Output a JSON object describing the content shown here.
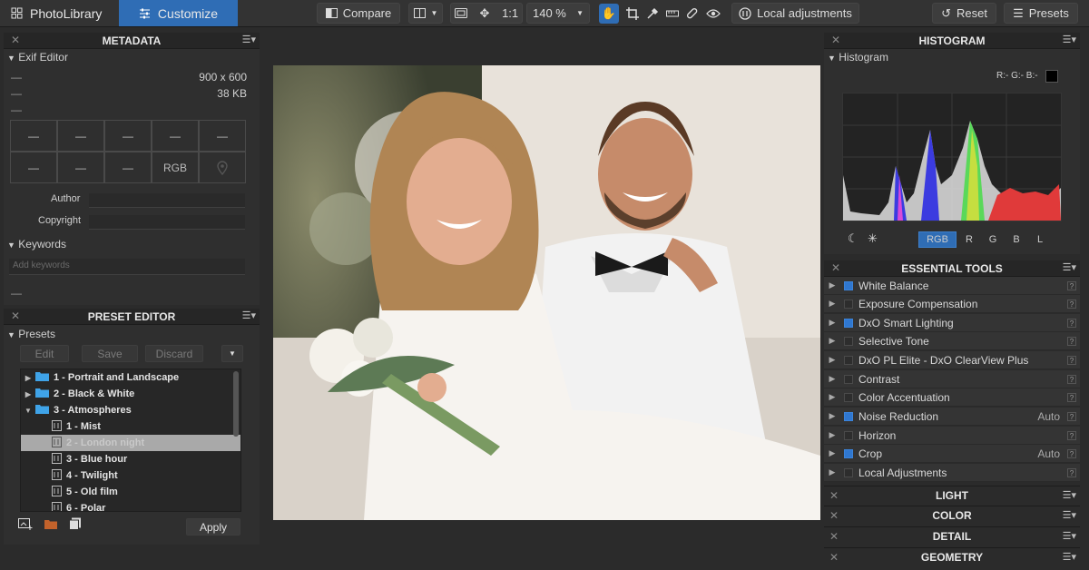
{
  "topbar": {
    "tabs": [
      {
        "label": "PhotoLibrary"
      },
      {
        "label": "Customize"
      }
    ],
    "compare_label": "Compare",
    "fit_label": "1:1",
    "zoom_value": "140 %",
    "local_adjustments_label": "Local adjustments",
    "reset_label": "Reset",
    "presets_label": "Presets",
    "accent_color": "#2f6db5"
  },
  "metadata": {
    "title": "METADATA",
    "exif_label": "Exif Editor",
    "rows": [
      "—",
      "—",
      "—"
    ],
    "dimensions": "900 x 600",
    "filesize": "38 KB",
    "grid": [
      "—",
      "—",
      "—",
      "—",
      "—",
      "—",
      "—",
      "—",
      "RGB",
      ""
    ],
    "author_label": "Author",
    "copyright_label": "Copyright",
    "keywords_label": "Keywords",
    "keywords_placeholder": "Add keywords",
    "footer_dash": "—"
  },
  "preset_editor": {
    "title": "PRESET EDITOR",
    "presets_label": "Presets",
    "edit_label": "Edit",
    "save_label": "Save",
    "discard_label": "Discard",
    "apply_label": "Apply",
    "items": [
      {
        "label": "1 - Portrait and Landscape",
        "type": "folder",
        "expanded": false
      },
      {
        "label": "2 - Black & White",
        "type": "folder",
        "expanded": false
      },
      {
        "label": "3 - Atmospheres",
        "type": "folder",
        "expanded": true
      },
      {
        "label": "1 - Mist",
        "type": "preset"
      },
      {
        "label": "2 - London night",
        "type": "preset",
        "selected": true
      },
      {
        "label": "3 - Blue hour",
        "type": "preset"
      },
      {
        "label": "4 - Twilight",
        "type": "preset"
      },
      {
        "label": "5 - Old film",
        "type": "preset"
      },
      {
        "label": "6 - Polar",
        "type": "preset"
      }
    ]
  },
  "histogram": {
    "title": "HISTOGRAM",
    "sub_label": "Histogram",
    "readout": "R:- G:- B:-",
    "channels": [
      "RGB",
      "R",
      "G",
      "B",
      "L"
    ],
    "active_channel": "RGB"
  },
  "essential_tools": {
    "title": "ESSENTIAL TOOLS",
    "items": [
      {
        "label": "White Balance",
        "enabled": true,
        "auto": ""
      },
      {
        "label": "Exposure Compensation",
        "enabled": false,
        "auto": ""
      },
      {
        "label": "DxO Smart Lighting",
        "enabled": true,
        "auto": ""
      },
      {
        "label": "Selective Tone",
        "enabled": false,
        "auto": ""
      },
      {
        "label": "DxO PL Elite - DxO ClearView Plus",
        "enabled": false,
        "auto": ""
      },
      {
        "label": "Contrast",
        "enabled": false,
        "auto": ""
      },
      {
        "label": "Color Accentuation",
        "enabled": false,
        "auto": ""
      },
      {
        "label": "Noise Reduction",
        "enabled": true,
        "auto": "Auto"
      },
      {
        "label": "Horizon",
        "enabled": false,
        "auto": ""
      },
      {
        "label": "Crop",
        "enabled": true,
        "auto": "Auto"
      },
      {
        "label": "Local Adjustments",
        "enabled": false,
        "auto": ""
      }
    ]
  },
  "sections": [
    "LIGHT",
    "COLOR",
    "DETAIL",
    "GEOMETRY"
  ]
}
